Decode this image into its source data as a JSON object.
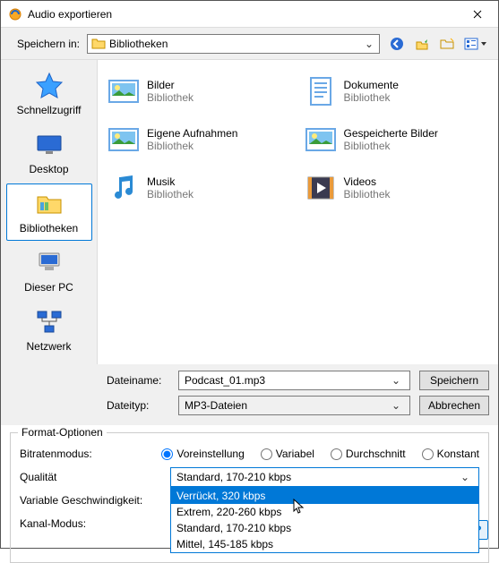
{
  "window": {
    "title": "Audio exportieren"
  },
  "toprow": {
    "label": "Speichern in:",
    "location": "Bibliotheken"
  },
  "places": [
    {
      "label": "Schnellzugriff"
    },
    {
      "label": "Desktop"
    },
    {
      "label": "Bibliotheken"
    },
    {
      "label": "Dieser PC"
    },
    {
      "label": "Netzwerk"
    }
  ],
  "libs": [
    {
      "name": "Bilder",
      "sub": "Bibliothek"
    },
    {
      "name": "Dokumente",
      "sub": "Bibliothek"
    },
    {
      "name": "Eigene Aufnahmen",
      "sub": "Bibliothek"
    },
    {
      "name": "Gespeicherte Bilder",
      "sub": "Bibliothek"
    },
    {
      "name": "Musik",
      "sub": "Bibliothek"
    },
    {
      "name": "Videos",
      "sub": "Bibliothek"
    }
  ],
  "filerow": {
    "name_label": "Dateiname:",
    "name_value": "Podcast_01.mp3",
    "type_label": "Dateityp:",
    "type_value": "MP3-Dateien",
    "save_btn": "Speichern",
    "cancel_btn": "Abbrechen"
  },
  "format": {
    "legend": "Format-Optionen",
    "bitrate_label": "Bitratenmodus:",
    "bitrate_options": {
      "preset": "Voreinstellung",
      "variable": "Variabel",
      "average": "Durchschnitt",
      "constant": "Konstant"
    },
    "quality_label": "Qualität",
    "quality_value": "Standard, 170-210 kbps",
    "quality_options": [
      "Verrückt, 320 kbps",
      "Extrem, 220-260 kbps",
      "Standard, 170-210 kbps",
      "Mittel, 145-185 kbps"
    ],
    "vbr_label": "Variable Geschwindigkeit:",
    "channel_label": "Kanal-Modus:"
  }
}
